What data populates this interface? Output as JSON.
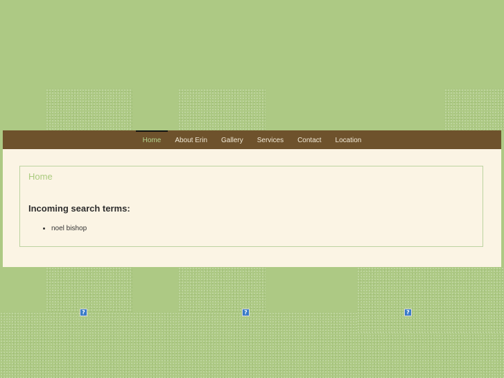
{
  "nav": {
    "items": [
      {
        "label": "Home",
        "active": true
      },
      {
        "label": "About Erin",
        "active": false
      },
      {
        "label": "Gallery",
        "active": false
      },
      {
        "label": "Services",
        "active": false
      },
      {
        "label": "Contact",
        "active": false
      },
      {
        "label": "Location",
        "active": false
      }
    ]
  },
  "main": {
    "page_title": "Home",
    "search_heading": "Incoming search terms:",
    "search_terms": [
      "noel bishop"
    ]
  },
  "broken_images": [
    {
      "glyph": "?"
    },
    {
      "glyph": "?"
    },
    {
      "glyph": "?"
    }
  ],
  "colors": {
    "background": "#adc984",
    "nav_bar": "#6e522c",
    "nav_active": "#b5d690",
    "content_bg": "#fbf4e4",
    "title": "#aacb7e"
  }
}
